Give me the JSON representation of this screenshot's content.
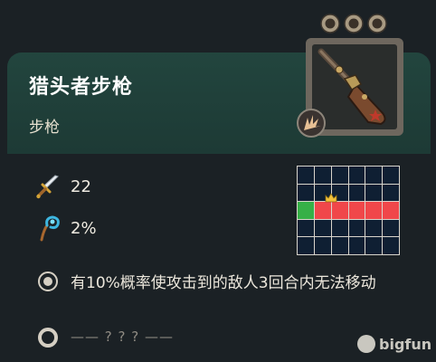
{
  "item": {
    "name": "猎头者步枪",
    "type": "步枪",
    "icon": "flintlock-rifle-icon",
    "attack_type_icon": "burst-attack-icon",
    "level_pips": 3
  },
  "stats": {
    "damage": {
      "icon": "sword-icon",
      "value": "22"
    },
    "crit": {
      "icon": "staff-crit-icon",
      "value": "2%"
    }
  },
  "attack_pattern": {
    "rows": 5,
    "cols": 6,
    "user_cell": [
      2,
      0
    ],
    "target_cells": [
      [
        2,
        1
      ],
      [
        2,
        2
      ],
      [
        2,
        3
      ],
      [
        2,
        4
      ],
      [
        2,
        5
      ]
    ],
    "colors": {
      "empty": "#0f1f33",
      "target": "#f0474a",
      "user": "#36b047"
    }
  },
  "effects": [
    {
      "text": "有10%概率使攻击到的敌人3回合内无法移动",
      "unlocked": true
    },
    {
      "text": "—— ? ? ? ——",
      "unlocked": false
    }
  ],
  "watermark": {
    "text": "bigfun"
  }
}
